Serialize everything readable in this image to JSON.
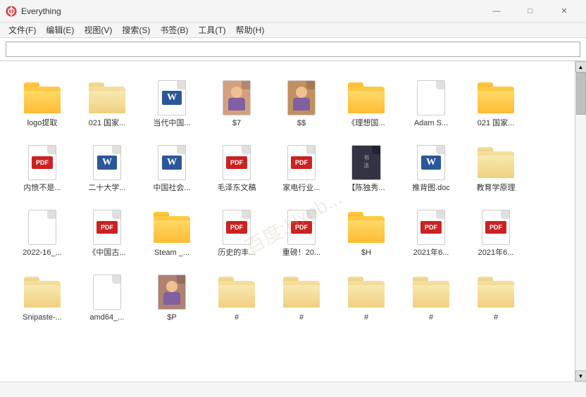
{
  "titleBar": {
    "title": "Everything",
    "minimizeLabel": "—",
    "maximizeLabel": "□",
    "closeLabel": "✕"
  },
  "menuBar": {
    "items": [
      "文件(F)",
      "编辑(E)",
      "视图(V)",
      "搜索(S)",
      "书签(B)",
      "工具(T)",
      "帮助(H)"
    ]
  },
  "searchBar": {
    "placeholder": ""
  },
  "files": [
    {
      "name": "logo提取",
      "type": "folder"
    },
    {
      "name": "021 国家...",
      "type": "folder-light"
    },
    {
      "name": "当代中国...",
      "type": "word"
    },
    {
      "name": "$7",
      "type": "image-person"
    },
    {
      "name": "$$",
      "type": "image-person2"
    },
    {
      "name": "《理想国...",
      "type": "folder"
    },
    {
      "name": "Adam S...",
      "type": "file"
    },
    {
      "name": "021 国家...",
      "type": "folder"
    },
    {
      "name": "内愤不是...",
      "type": "pdf"
    },
    {
      "name": "二十大学...",
      "type": "word"
    },
    {
      "name": "中国社会...",
      "type": "word"
    },
    {
      "name": "毛泽东文稿",
      "type": "pdf-red"
    },
    {
      "name": "家电行业...",
      "type": "pdf"
    },
    {
      "name": "【陈独秀...",
      "type": "screenshot"
    },
    {
      "name": "推背图.doc",
      "type": "word"
    },
    {
      "name": "教育学原理",
      "type": "folder-doc"
    },
    {
      "name": "2022-16_...",
      "type": "file"
    },
    {
      "name": "《中国古...",
      "type": "pdf"
    },
    {
      "name": "Steam _...",
      "type": "folder-steam"
    },
    {
      "name": "历史的丰...",
      "type": "pdf-red"
    },
    {
      "name": "重磅！20...",
      "type": "pdf"
    },
    {
      "name": "$H",
      "type": "folder"
    },
    {
      "name": "2021年6...",
      "type": "pdf"
    },
    {
      "name": "2021年6...",
      "type": "pdf"
    },
    {
      "name": "Snipaste-...",
      "type": "folder-light"
    },
    {
      "name": "amd64_...",
      "type": "file-script"
    },
    {
      "name": "$P",
      "type": "image-person3"
    },
    {
      "name": "#",
      "type": "folder-light"
    },
    {
      "name": "#",
      "type": "folder-light"
    },
    {
      "name": "#",
      "type": "folder-light"
    },
    {
      "name": "#",
      "type": "folder-light"
    },
    {
      "name": "#",
      "type": "folder-light"
    }
  ],
  "statusBar": {
    "text": ""
  }
}
